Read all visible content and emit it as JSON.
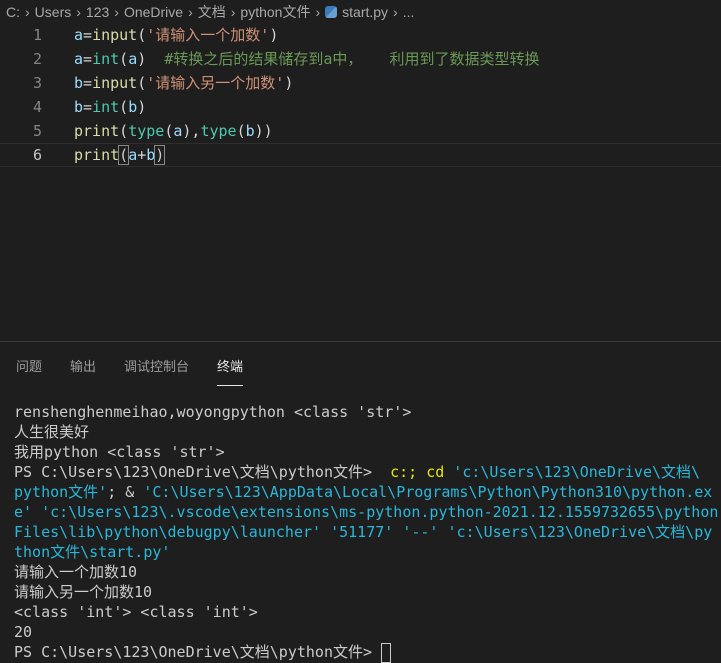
{
  "breadcrumb": [
    "C:",
    "Users",
    "123",
    "OneDrive",
    "文档",
    "python文件",
    "start.py",
    "..."
  ],
  "editor": {
    "current_line": 6,
    "lines": [
      [
        [
          "var",
          "a"
        ],
        [
          "op",
          "="
        ],
        [
          "fn",
          "input"
        ],
        [
          "op",
          "("
        ],
        [
          "str",
          "'请输入一个加数'"
        ],
        [
          "op",
          ")"
        ]
      ],
      [
        [
          "var",
          "a"
        ],
        [
          "op",
          "="
        ],
        [
          "type",
          "int"
        ],
        [
          "op",
          "("
        ],
        [
          "var",
          "a"
        ],
        [
          "op",
          ")"
        ],
        [
          "plain",
          "  "
        ],
        [
          "cmt",
          "#转换之后的结果储存到a中，   利用到了数据类型转换"
        ]
      ],
      [
        [
          "var",
          "b"
        ],
        [
          "op",
          "="
        ],
        [
          "fn",
          "input"
        ],
        [
          "op",
          "("
        ],
        [
          "str",
          "'请输入另一个加数'"
        ],
        [
          "op",
          ")"
        ]
      ],
      [
        [
          "var",
          "b"
        ],
        [
          "op",
          "="
        ],
        [
          "type",
          "int"
        ],
        [
          "op",
          "("
        ],
        [
          "var",
          "b"
        ],
        [
          "op",
          ")"
        ]
      ],
      [
        [
          "fn",
          "print"
        ],
        [
          "op",
          "("
        ],
        [
          "type",
          "type"
        ],
        [
          "op",
          "("
        ],
        [
          "var",
          "a"
        ],
        [
          "op",
          "),"
        ],
        [
          "type",
          "type"
        ],
        [
          "op",
          "("
        ],
        [
          "var",
          "b"
        ],
        [
          "op",
          "))"
        ]
      ],
      [
        [
          "fn",
          "print"
        ],
        [
          "br",
          "("
        ],
        [
          "var",
          "a"
        ],
        [
          "op",
          "+"
        ],
        [
          "var",
          "b"
        ],
        [
          "br",
          ")"
        ]
      ]
    ]
  },
  "panel": {
    "tabs": [
      "问题",
      "输出",
      "调试控制台",
      "终端"
    ],
    "active_tab": 3
  },
  "terminal": {
    "lines": [
      [
        [
          "w",
          "renshenghenmeihao,woyongpython <class 'str'>"
        ]
      ],
      [
        [
          "w",
          "人生很美好"
        ]
      ],
      [
        [
          "w",
          "我用python <class 'str'>"
        ]
      ],
      [
        [
          "w",
          "PS C:\\Users\\123\\OneDrive\\文档\\python文件>  "
        ],
        [
          "y",
          "c:; cd "
        ],
        [
          "c",
          "'c:\\Users\\123\\OneDrive\\文档\\"
        ]
      ],
      [
        [
          "c",
          "python文件'"
        ],
        [
          "w",
          "; & "
        ],
        [
          "c",
          "'C:\\Users\\123\\AppData\\Local\\Programs\\Python\\Python310\\python.ex"
        ]
      ],
      [
        [
          "c",
          "e' 'c:\\Users\\123\\.vscode\\extensions\\ms-python.python-2021.12.1559732655\\python"
        ]
      ],
      [
        [
          "c",
          "Files\\lib\\python\\debugpy\\launcher' '51177' '--' 'c:\\Users\\123\\OneDrive\\文档\\py"
        ]
      ],
      [
        [
          "c",
          "thon文件\\start.py'"
        ]
      ],
      [
        [
          "w",
          "请输入一个加数10"
        ]
      ],
      [
        [
          "w",
          "请输入另一个加数10"
        ]
      ],
      [
        [
          "w",
          "<class 'int'> <class 'int'>"
        ]
      ],
      [
        [
          "w",
          "20"
        ]
      ],
      [
        [
          "w",
          "PS C:\\Users\\123\\OneDrive\\文档\\python文件> "
        ],
        [
          "cursor",
          ""
        ]
      ]
    ]
  },
  "colors": {
    "background": "#1e1e1e",
    "comment": "#6a9955",
    "string": "#ce9178",
    "terminal_yellow": "#e5e510",
    "terminal_cyan": "#29b8db"
  }
}
